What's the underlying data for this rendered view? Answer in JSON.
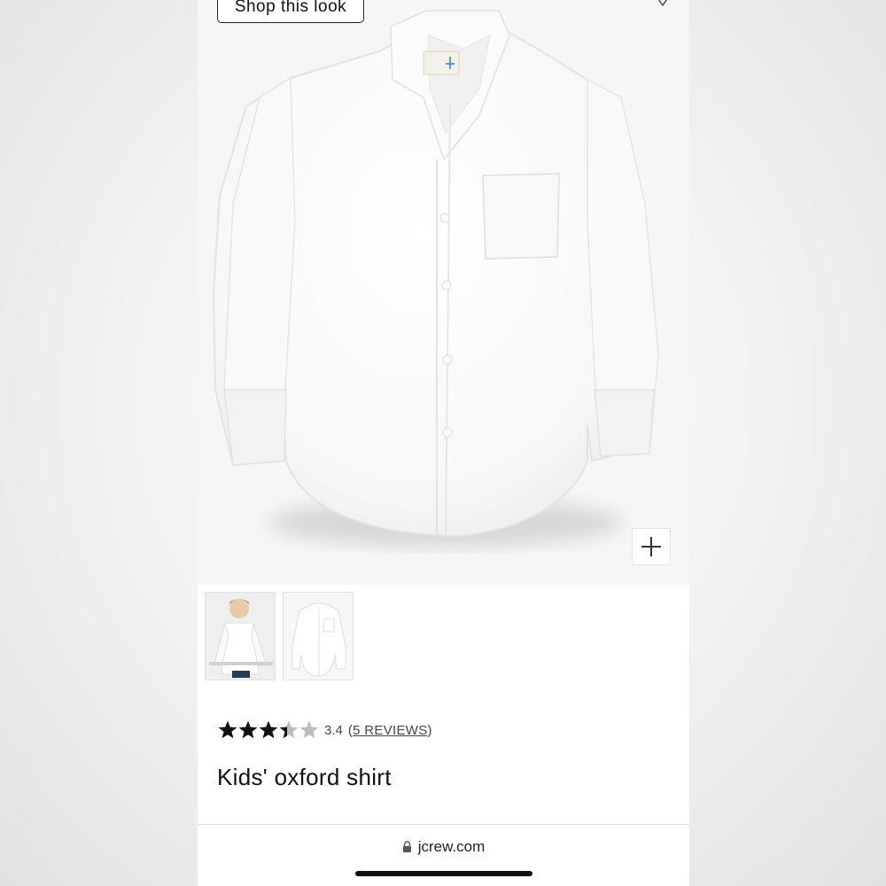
{
  "hero": {
    "shop_look_label": "Shop this look",
    "zoom_icon": "plus-icon",
    "favorite_icon": "heart-icon"
  },
  "thumbnails": [
    {
      "name": "thumbnail-model",
      "selected": false
    },
    {
      "name": "thumbnail-shirt",
      "selected": true
    }
  ],
  "product": {
    "rating_value": "3.4",
    "rating_fraction": 0.68,
    "reviews_label": "5 REVIEWS",
    "title": "Kids' oxford shirt"
  },
  "browser": {
    "url": "jcrew.com",
    "lock_icon": "lock-icon"
  },
  "colors": {
    "star_filled": "#111111",
    "star_empty": "#bdbdbd"
  }
}
